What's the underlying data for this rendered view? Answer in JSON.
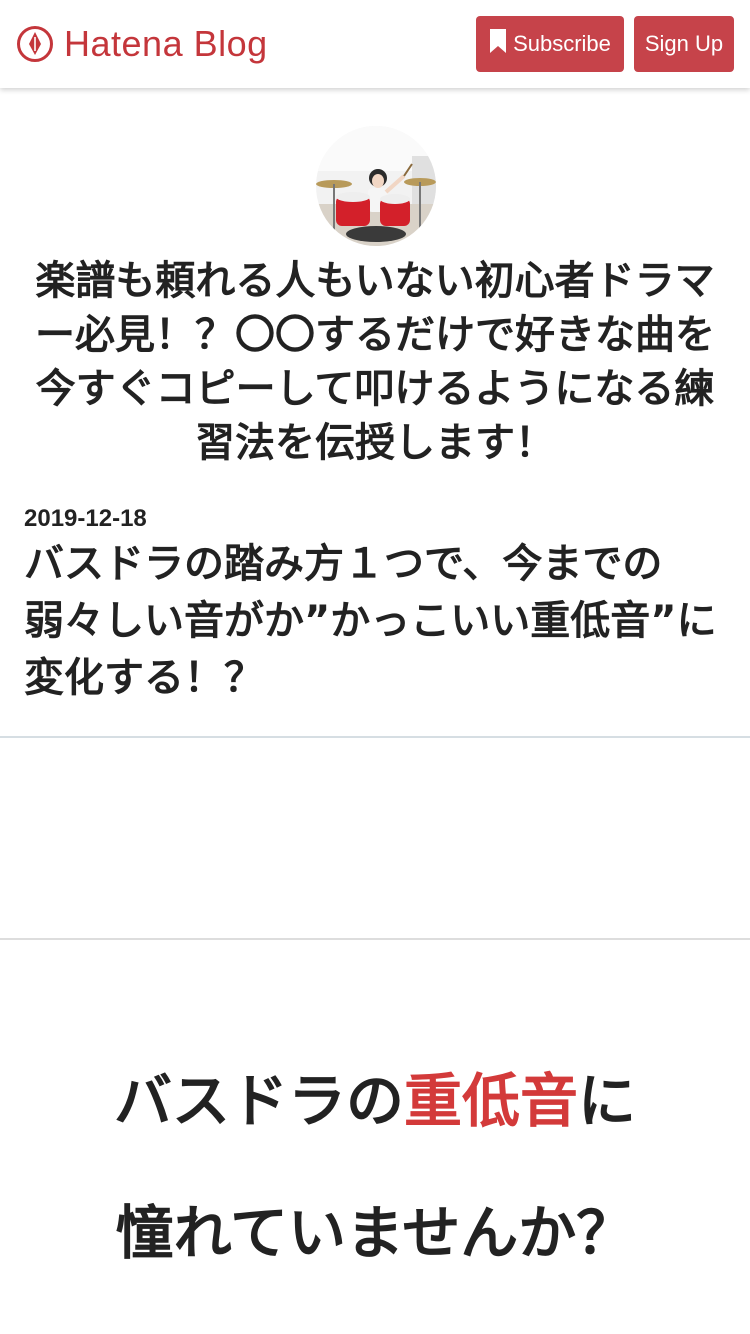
{
  "header": {
    "logo_text": "Hatena Blog",
    "subscribe_label": "Subscribe",
    "signup_label": "Sign Up",
    "brand_color": "#c4363b",
    "button_color": "#c6434a"
  },
  "blog": {
    "title": "楽譜も頼れる人もいない初心者ドラマー必見！？〇〇するだけで好きな曲を今すぐコピーして叩けるようになる練習法を伝授します！"
  },
  "entry": {
    "date": "2019-12-18",
    "title": "バスドラの踏み方１つで、今までの弱々しい音がか”かっこいい重低音”に変化する！？"
  },
  "content": {
    "headline_line1_pre": "バスドラの",
    "headline_line1_accent": "重低音",
    "headline_line1_post": "に",
    "headline_line2": "憧れていませんか？",
    "accent_color": "#d33a3a"
  }
}
